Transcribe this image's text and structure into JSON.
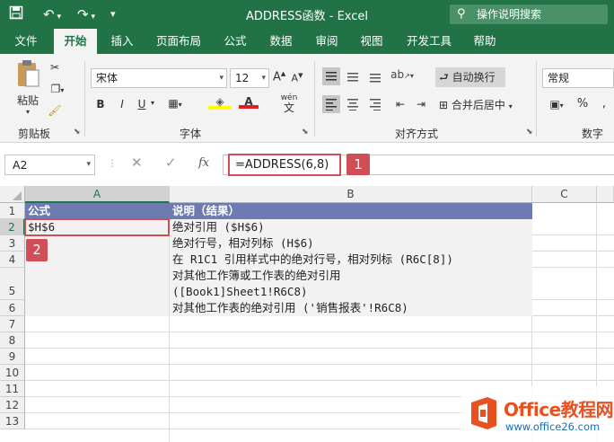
{
  "title": "ADDRESS函数  -  Excel",
  "search_placeholder": "操作说明搜索",
  "tabs": [
    "文件",
    "开始",
    "插入",
    "页面布局",
    "公式",
    "数据",
    "审阅",
    "视图",
    "开发工具",
    "帮助"
  ],
  "ribbon": {
    "clipboard": {
      "paste": "粘贴",
      "group": "剪贴板"
    },
    "font": {
      "name": "宋体",
      "size": "12",
      "bold": "B",
      "italic": "I",
      "underline": "U",
      "wen": "wén",
      "group": "字体"
    },
    "align": {
      "wrap": "自动换行",
      "merge": "合并后居中",
      "group": "对齐方式"
    },
    "number": {
      "format": "常规",
      "percent": "%",
      "group": "数字"
    }
  },
  "formula_bar": {
    "name_box": "A2",
    "fx": "fx",
    "formula": "=ADDRESS(6,8)",
    "badge": "1"
  },
  "columns": [
    "A",
    "B",
    "C"
  ],
  "rows": [
    "1",
    "2",
    "3",
    "4",
    "5",
    "6",
    "7",
    "8",
    "9",
    "10",
    "11",
    "12",
    "13"
  ],
  "table": {
    "header": {
      "a": "公式",
      "b": "说明（结果）"
    },
    "a2": "$H$6",
    "b_lines": [
      "绝对引用 ($H$6)",
      "绝对行号，相对列标 (H$6)",
      "在 R1C1 引用样式中的绝对行号，相对列标 (R6C[8])",
      "对其他工作簿或工作表的绝对引用",
      "([Book1]Sheet1!R6C8)",
      "对其他工作表的绝对引用 ('销售报表'!R6C8)"
    ]
  },
  "cell_badge": "2",
  "watermark": {
    "brand": "Office教程网",
    "url": "www.office26.com"
  },
  "colors": {
    "excel_green": "#217346",
    "header_fill": "#6d7bb0",
    "data_fill": "#f2f2f2",
    "highlight": "#d04f56",
    "brand_orange": "#e8511f"
  }
}
